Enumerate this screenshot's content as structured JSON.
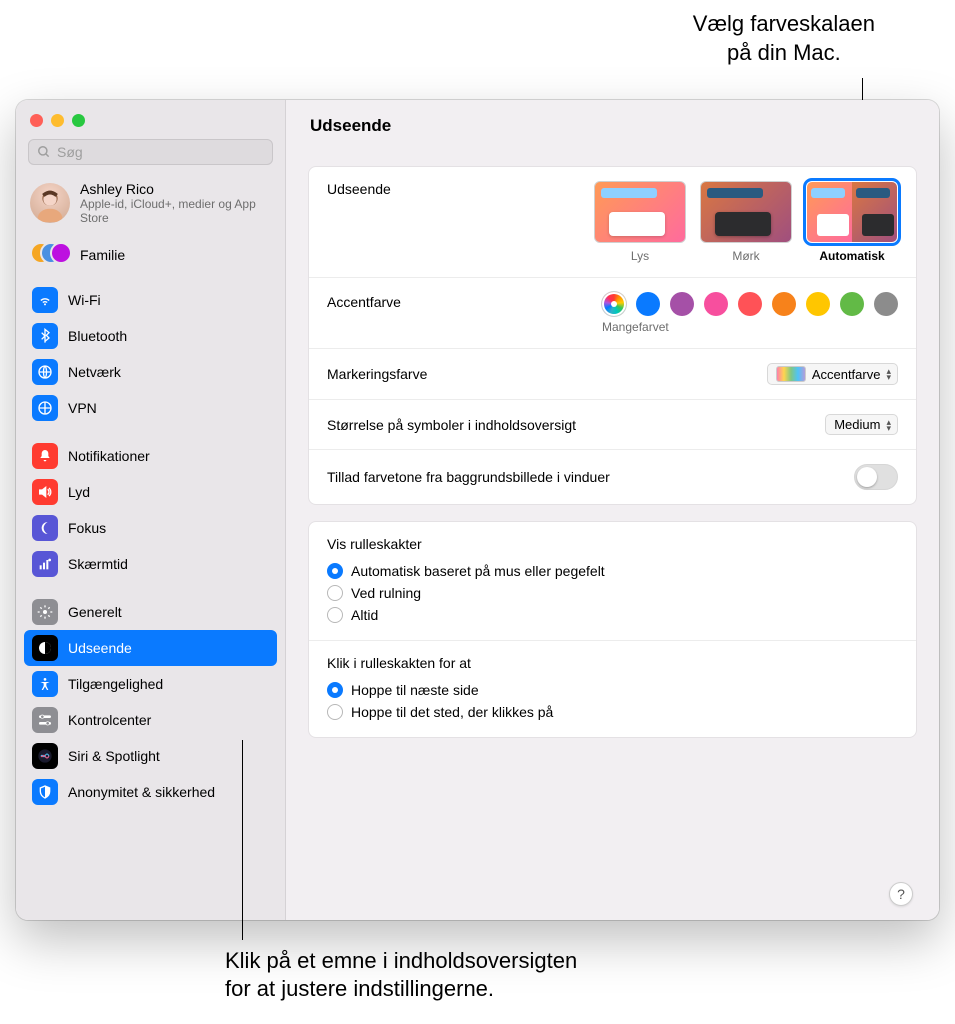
{
  "callouts": {
    "top": "Vælg farveskalaen\npå din Mac.",
    "bottom": "Klik på et emne i indholdsoversigten\nfor at justere indstillingerne."
  },
  "search": {
    "placeholder": "Søg"
  },
  "profile": {
    "name": "Ashley Rico",
    "sub": "Apple-id, iCloud+, medier og App Store"
  },
  "family_label": "Familie",
  "sidebar_groups": [
    [
      {
        "id": "wifi",
        "label": "Wi-Fi",
        "color": "#0a7aff"
      },
      {
        "id": "bluetooth",
        "label": "Bluetooth",
        "color": "#0a7aff"
      },
      {
        "id": "network",
        "label": "Netværk",
        "color": "#0a7aff"
      },
      {
        "id": "vpn",
        "label": "VPN",
        "color": "#0a7aff"
      }
    ],
    [
      {
        "id": "notifications",
        "label": "Notifikationer",
        "color": "#ff3b30"
      },
      {
        "id": "sound",
        "label": "Lyd",
        "color": "#ff3b30"
      },
      {
        "id": "focus",
        "label": "Fokus",
        "color": "#5856d6"
      },
      {
        "id": "screentime",
        "label": "Skærmtid",
        "color": "#5856d6"
      }
    ],
    [
      {
        "id": "general",
        "label": "Generelt",
        "color": "#8e8e93"
      },
      {
        "id": "appearance",
        "label": "Udseende",
        "color": "#000000",
        "selected": true
      },
      {
        "id": "accessibility",
        "label": "Tilgængelighed",
        "color": "#0a7aff"
      },
      {
        "id": "controlcenter",
        "label": "Kontrolcenter",
        "color": "#8e8e93"
      },
      {
        "id": "siri",
        "label": "Siri & Spotlight",
        "color": "#000000"
      },
      {
        "id": "privacy",
        "label": "Anonymitet & sikkerhed",
        "color": "#0a7aff"
      }
    ]
  ],
  "content": {
    "title": "Udseende",
    "appearance": {
      "label": "Udseende",
      "options": [
        {
          "id": "lys",
          "caption": "Lys"
        },
        {
          "id": "mork",
          "caption": "Mørk"
        },
        {
          "id": "auto",
          "caption": "Automatisk",
          "selected": true
        }
      ]
    },
    "accent": {
      "label": "Accentfarve",
      "caption": "Mangefarvet",
      "colors": [
        "multi",
        "#0a7aff",
        "#a550a7",
        "#f74f9e",
        "#ff5257",
        "#f7821b",
        "#ffc600",
        "#62ba46",
        "#8c8c8c"
      ]
    },
    "highlight": {
      "label": "Markeringsfarve",
      "value": "Accentfarve"
    },
    "sidebar_icon": {
      "label": "Størrelse på symboler i indholdsoversigt",
      "value": "Medium"
    },
    "tint": {
      "label": "Tillad farvetone fra baggrundsbillede i vinduer",
      "on": false
    },
    "scrollbar_show": {
      "title": "Vis rulleskakter",
      "options": [
        {
          "label": "Automatisk baseret på mus eller pegefelt",
          "checked": true
        },
        {
          "label": "Ved rulning",
          "checked": false
        },
        {
          "label": "Altid",
          "checked": false
        }
      ]
    },
    "scrollbar_click": {
      "title": "Klik i rulleskakten for at",
      "options": [
        {
          "label": "Hoppe til næste side",
          "checked": true
        },
        {
          "label": "Hoppe til det sted, der klikkes på",
          "checked": false
        }
      ]
    }
  },
  "help_glyph": "?"
}
